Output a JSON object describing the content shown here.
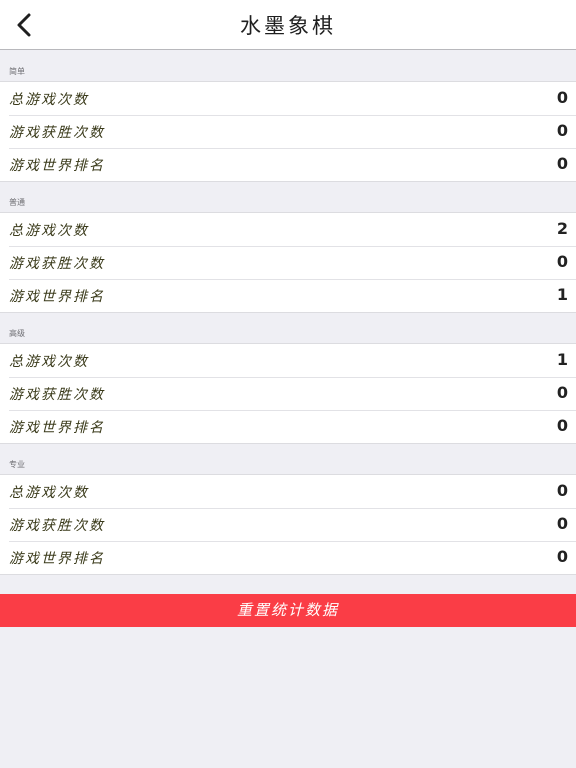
{
  "nav": {
    "title": "水墨象棋",
    "back_icon": "chevron-left-icon"
  },
  "sections": [
    {
      "header": "简单",
      "rows": [
        {
          "label": "总游戏次数",
          "value": "0"
        },
        {
          "label": "游戏获胜次数",
          "value": "0"
        },
        {
          "label": "游戏世界排名",
          "value": "0"
        }
      ]
    },
    {
      "header": "普通",
      "rows": [
        {
          "label": "总游戏次数",
          "value": "2"
        },
        {
          "label": "游戏获胜次数",
          "value": "0"
        },
        {
          "label": "游戏世界排名",
          "value": "1"
        }
      ]
    },
    {
      "header": "高级",
      "rows": [
        {
          "label": "总游戏次数",
          "value": "1"
        },
        {
          "label": "游戏获胜次数",
          "value": "0"
        },
        {
          "label": "游戏世界排名",
          "value": "0"
        }
      ]
    },
    {
      "header": "专业",
      "rows": [
        {
          "label": "总游戏次数",
          "value": "0"
        },
        {
          "label": "游戏获胜次数",
          "value": "0"
        },
        {
          "label": "游戏世界排名",
          "value": "0"
        }
      ]
    }
  ],
  "reset_button": {
    "label": "重置统计数据",
    "color": "#fa3d46"
  },
  "colors": {
    "background": "#efeff4",
    "label_text": "#3a3a1a"
  }
}
